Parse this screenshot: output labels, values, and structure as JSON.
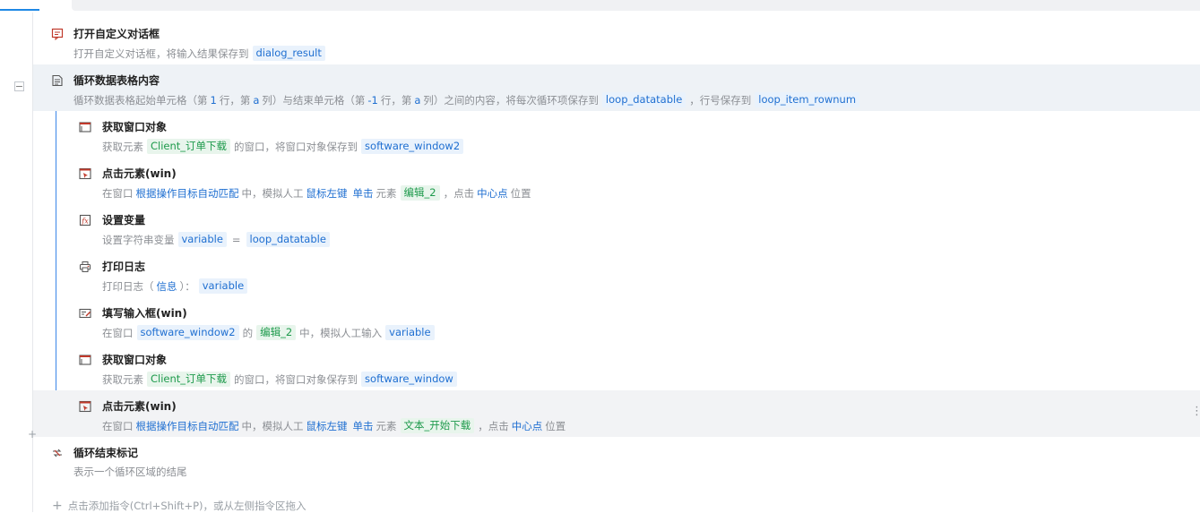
{
  "rows": [
    {
      "title": "打开自定义对话框",
      "icon": "dialog-icon",
      "desc": [
        "打开自定义对话框，将输入结果保存到",
        "dialog_result"
      ]
    },
    {
      "title": "循环数据表格内容",
      "icon": "loop-table-icon",
      "desc": [
        "循环数据表格起始单元格（第",
        "1",
        "行，第",
        "a",
        "列）与结束单元格（第",
        "-1",
        "行，第",
        "a",
        "列）之间的内容，将每次循环项保存到",
        "loop_datatable",
        "，行号保存到",
        "loop_item_rownum"
      ]
    },
    {
      "title": "获取窗口对象",
      "icon": "window-icon",
      "desc": [
        "获取元素",
        "Client_订单下载",
        "的窗口，将窗口对象保存到",
        "software_window2"
      ]
    },
    {
      "title": "点击元素(win)",
      "icon": "click-element-icon",
      "desc": [
        "在窗口",
        "根据操作目标自动匹配",
        "中，模拟人工",
        "鼠标左键",
        "单击",
        "元素",
        "编辑_2",
        "，点击",
        "中心点",
        "位置"
      ]
    },
    {
      "title": "设置变量",
      "icon": "variable-icon",
      "desc": [
        "设置字符串变量",
        "variable",
        "=",
        "loop_datatable"
      ]
    },
    {
      "title": "打印日志",
      "icon": "printer-icon",
      "desc": [
        "打印日志（",
        "信息",
        "）：",
        "variable"
      ]
    },
    {
      "title": "填写输入框(win)",
      "icon": "input-box-icon",
      "desc": [
        "在窗口",
        "software_window2",
        "的",
        "编辑_2",
        "中，模拟人工输入",
        "variable"
      ]
    },
    {
      "title": "获取窗口对象",
      "icon": "window-icon",
      "desc": [
        "获取元素",
        "Client_订单下载",
        "的窗口，将窗口对象保存到",
        "software_window"
      ]
    },
    {
      "title": "点击元素(win)",
      "icon": "click-element-icon",
      "desc": [
        "在窗口",
        "根据操作目标自动匹配",
        "中，模拟人工",
        "鼠标左键",
        "单击",
        "元素",
        "文本_开始下载",
        "，点击",
        "中心点",
        "位置"
      ]
    },
    {
      "title": "循环结束标记",
      "icon": "loop-end-icon",
      "desc": [
        "表示一个循环区域的结尾"
      ]
    }
  ],
  "collapse_symbol": "−",
  "add_symbol": "+",
  "more_symbol": "⋮",
  "add_hint": "点击添加指令(Ctrl+Shift+P)，或从左侧指令区拖入",
  "colors": {
    "accent": "#1f6fd1",
    "green": "#1d9a4b",
    "loop_line": "#3a86e8",
    "selected_row": "#eef2f6"
  }
}
